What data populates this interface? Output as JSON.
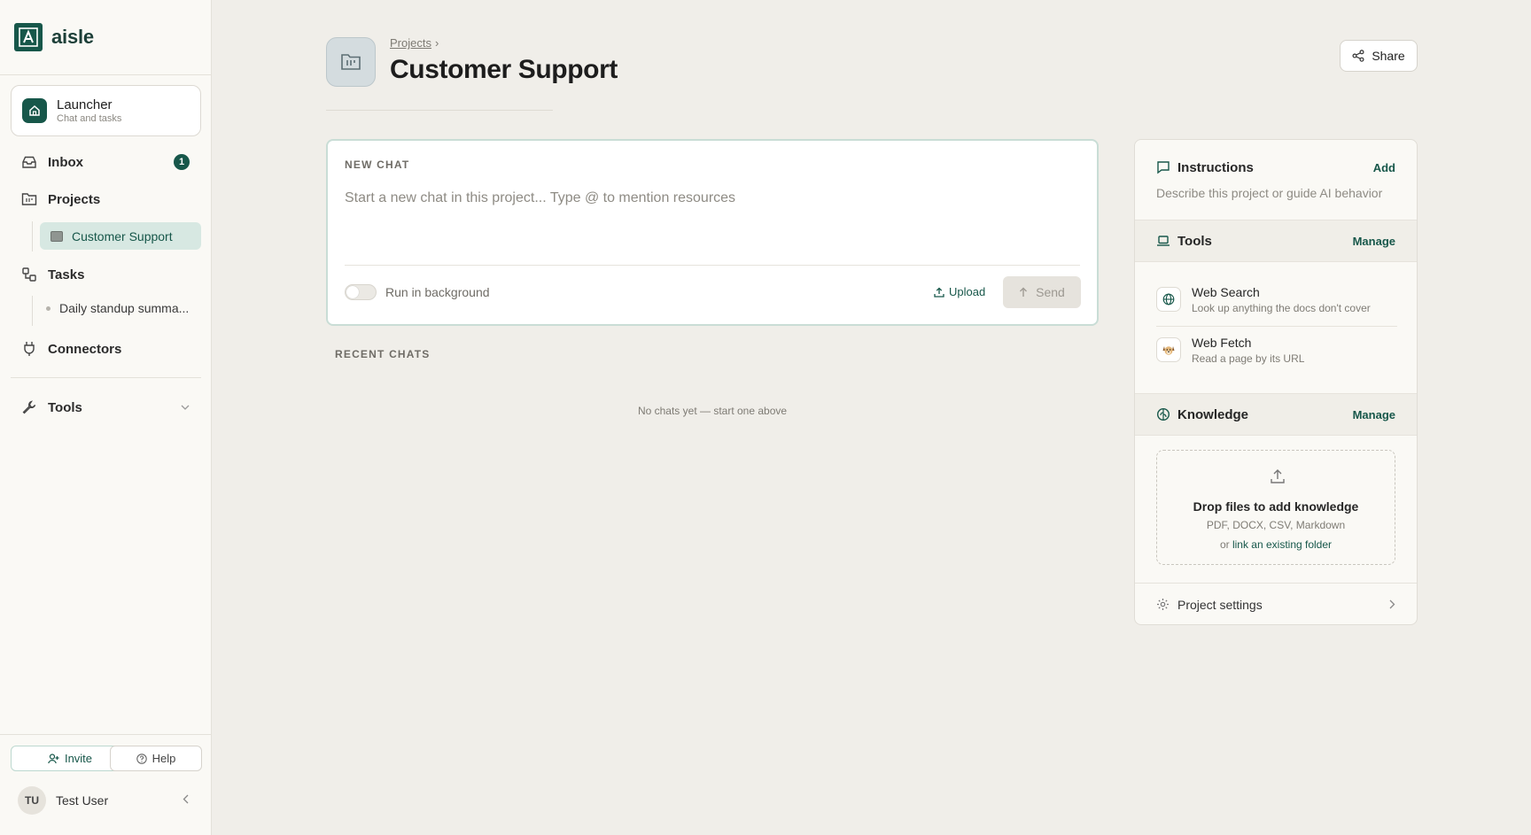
{
  "brand": {
    "name": "aisle",
    "accent": "#17574a"
  },
  "sidebar": {
    "launcher": {
      "title": "Launcher",
      "subtitle": "Chat and tasks"
    },
    "inbox": {
      "label": "Inbox",
      "badge": "1"
    },
    "projects": {
      "label": "Projects",
      "children": [
        {
          "label": "Customer Support",
          "active": true
        }
      ]
    },
    "tasks": {
      "label": "Tasks",
      "children": [
        {
          "label": "Daily standup summa..."
        }
      ]
    },
    "connectors": {
      "label": "Connectors"
    },
    "tools": {
      "label": "Tools"
    },
    "invite_label": "Invite",
    "help_label": "Help",
    "user": {
      "initials": "TU",
      "name": "Test User"
    }
  },
  "header": {
    "breadcrumb": {
      "label": "Projects",
      "separator": "›"
    },
    "title": "Customer Support",
    "share_label": "Share"
  },
  "new_chat": {
    "heading": "NEW CHAT",
    "placeholder": "Start a new chat in this project... Type @ to mention resources",
    "run_in_background_label": "Run in background",
    "run_in_background": false,
    "upload_label": "Upload",
    "send_label": "Send"
  },
  "recent": {
    "heading": "RECENT CHATS",
    "empty_text": "No chats yet — start one above"
  },
  "panel": {
    "instructions": {
      "title": "Instructions",
      "action": "Add",
      "description": "Describe this project or guide AI behavior"
    },
    "tools": {
      "title": "Tools",
      "action": "Manage",
      "items": [
        {
          "name": "Web Search",
          "description": "Look up anything the docs don't cover",
          "icon": "globe-icon"
        },
        {
          "name": "Web Fetch",
          "description": "Read a page by its URL",
          "icon": "dog-icon"
        }
      ]
    },
    "knowledge": {
      "title": "Knowledge",
      "action": "Manage",
      "drop_title": "Drop files to add knowledge",
      "drop_types": "PDF, DOCX, CSV, Markdown",
      "drop_or": "or",
      "drop_link": "link an existing folder"
    },
    "settings_label": "Project settings"
  }
}
